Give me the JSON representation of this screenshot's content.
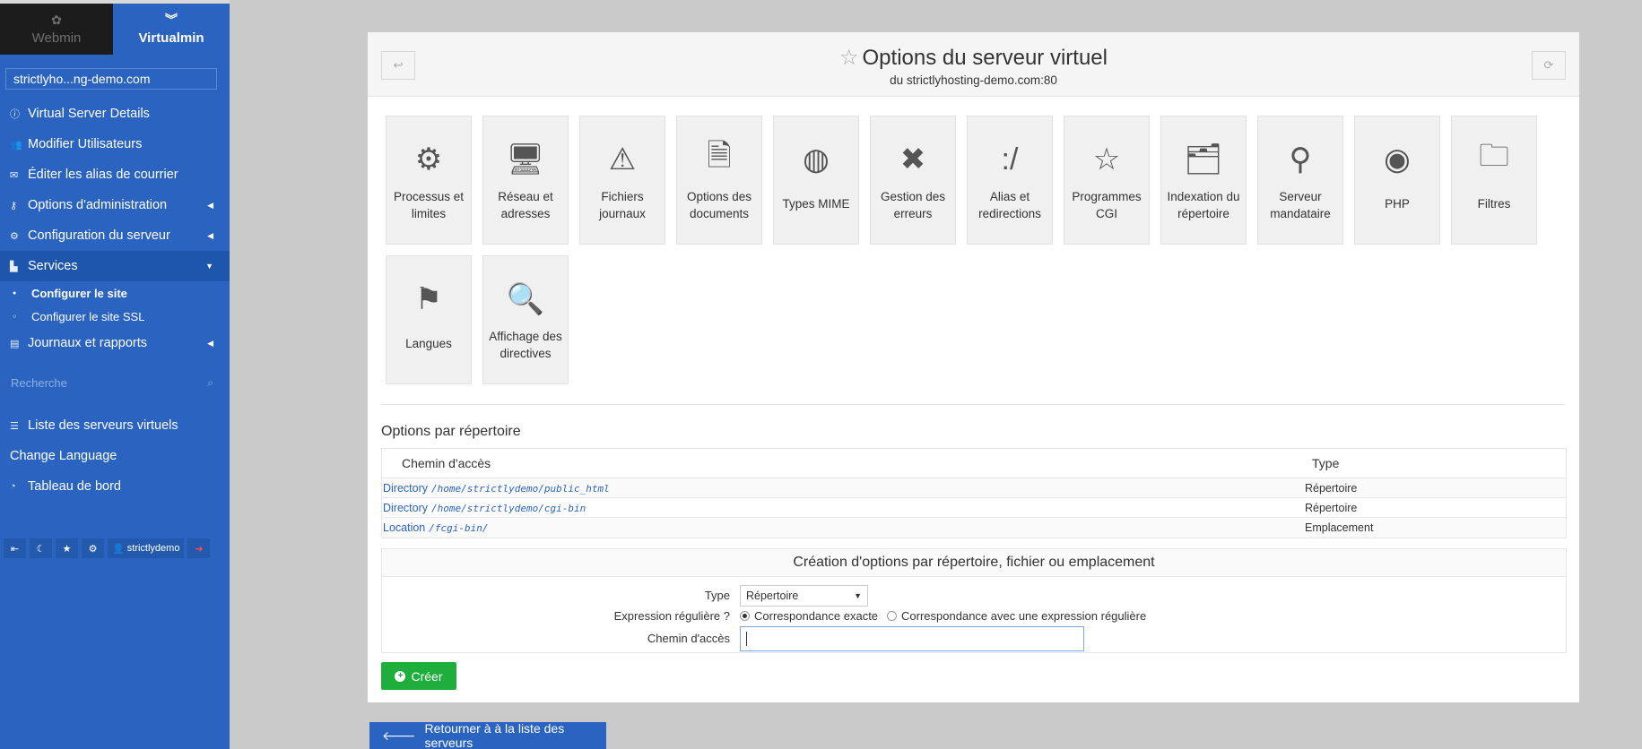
{
  "sidebar": {
    "tabs": {
      "webmin": "Webmin",
      "virtualmin": "Virtualmin"
    },
    "domain": "strictlyho...ng-demo.com",
    "menu": [
      {
        "label": "Virtual Server Details",
        "icon": "info-icon"
      },
      {
        "label": "Modifier Utilisateurs",
        "icon": "users-icon"
      },
      {
        "label": "Éditer les alias de courrier",
        "icon": "envelope-icon"
      },
      {
        "label": "Options d'administration",
        "icon": "key-icon"
      },
      {
        "label": "Configuration du serveur",
        "icon": "cogs-icon"
      },
      {
        "label": "Services",
        "icon": "sitemap-icon"
      }
    ],
    "submenu": [
      "Configurer le site",
      "Configurer le site SSL"
    ],
    "logs": "Journaux et rapports",
    "search_placeholder": "Recherche",
    "menu2": [
      "Liste des serveurs virtuels",
      "Change Language",
      "Tableau de bord"
    ],
    "footer_user": "strictlydemo"
  },
  "panel": {
    "title": "Options du serveur virtuel",
    "subtitle": "du strictlyhosting-demo.com:80",
    "icons": [
      {
        "label": "Processus et limites",
        "icon": "gears-icon"
      },
      {
        "label": "Réseau et adresses",
        "icon": "network-computer-icon"
      },
      {
        "label": "Fichiers journaux",
        "icon": "warning-log-icon"
      },
      {
        "label": "Options des documents",
        "icon": "documents-icon"
      },
      {
        "label": "Types MIME",
        "icon": "mime-icon"
      },
      {
        "label": "Gestion des erreurs",
        "icon": "error-x-icon"
      },
      {
        "label": "Alias et redirections",
        "icon": "alias-icon"
      },
      {
        "label": "Programmes CGI",
        "icon": "star-cgi-icon"
      },
      {
        "label": "Indexation du répertoire",
        "icon": "folder-index-icon"
      },
      {
        "label": "Serveur mandataire",
        "icon": "proxy-icon"
      },
      {
        "label": "PHP",
        "icon": "php-icon"
      },
      {
        "label": "Filtres",
        "icon": "filter-folder-icon"
      },
      {
        "label": "Langues",
        "icon": "languages-icon"
      },
      {
        "label": "Affichage des directives",
        "icon": "magnifier-icon"
      }
    ],
    "dir_options_title": "Options par répertoire",
    "table": {
      "headers": [
        "Chemin d'accès",
        "Type"
      ],
      "rows": [
        {
          "kind": "Directory",
          "path": "/home/strictlydemo/public_html",
          "type": "Répertoire"
        },
        {
          "kind": "Directory",
          "path": "/home/strictlydemo/cgi-bin",
          "type": "Répertoire"
        },
        {
          "kind": "Location",
          "path": "/fcgi-bin/",
          "type": "Emplacement"
        }
      ]
    },
    "form": {
      "title": "Création d'options par répertoire, fichier ou emplacement",
      "type_label": "Type",
      "type_value": "Répertoire",
      "regex_label": "Expression régulière ?",
      "regex_opt1": "Correspondance exacte",
      "regex_opt2": "Correspondance avec une expression régulière",
      "path_label": "Chemin d'accès"
    },
    "create_button": "Créer"
  },
  "back_button": "Retourner à à la liste des serveurs"
}
